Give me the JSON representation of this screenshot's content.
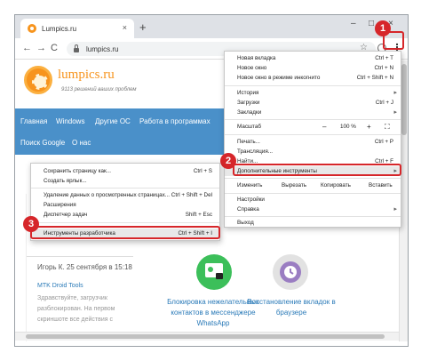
{
  "browser": {
    "tab_title": "Lumpics.ru",
    "tab_close": "×",
    "new_tab": "+",
    "url": "lumpics.ru",
    "nav": {
      "back": "←",
      "forward": "→",
      "reload": "C"
    },
    "star": "☆",
    "menu_dots": "⋮",
    "window": {
      "minimize": "–",
      "maximize": "□",
      "close": "×"
    }
  },
  "site": {
    "name": "lumpics.ru",
    "tagline": "9113 решений ваших проблем",
    "nav": [
      "Главная",
      "Windows",
      "Другие ОС",
      "Работа в программах",
      "Поиск Google",
      "О нас"
    ],
    "author": "Игорь К. 25 сентября в 15:18",
    "link": "MTK Droid Tools",
    "snippet": "Здравствуйте, загрузчик разблокирован. На первом скриншоте все действия с",
    "cards": [
      "Блокировка нежелательных контактов в мессенджере WhatsApp",
      "Восстановление вкладок в браузере"
    ]
  },
  "main_menu": {
    "items_top": [
      {
        "label": "Новая вкладка",
        "shortcut": "Ctrl + T"
      },
      {
        "label": "Новое окно",
        "shortcut": "Ctrl + N"
      },
      {
        "label": "Новое окно в режиме инкогнито",
        "shortcut": "Ctrl + Shift + N"
      }
    ],
    "items_mid": [
      {
        "label": "История",
        "arrow": "▸"
      },
      {
        "label": "Загрузки",
        "shortcut": "Ctrl + J"
      },
      {
        "label": "Закладки",
        "arrow": "▸"
      }
    ],
    "zoom": {
      "label": "Масштаб",
      "minus": "–",
      "value": "100 %",
      "plus": "+",
      "fullscreen": "⛶"
    },
    "items_tools": [
      {
        "label": "Печать...",
        "shortcut": "Ctrl + P"
      },
      {
        "label": "Трансляция..."
      },
      {
        "label": "Найти...",
        "shortcut": "Ctrl + F"
      },
      {
        "label": "Дополнительные инструменты",
        "arrow": "▸"
      }
    ],
    "edit": {
      "label": "Изменить",
      "cut": "Вырезать",
      "copy": "Копировать",
      "paste": "Вставить"
    },
    "items_bottom": [
      {
        "label": "Настройки"
      },
      {
        "label": "Справка",
        "arrow": "▸"
      }
    ],
    "exit": "Выход"
  },
  "sub_menu": {
    "items": [
      {
        "label": "Сохранить страницу как...",
        "shortcut": "Ctrl + S"
      },
      {
        "label": "Создать ярлык..."
      },
      {
        "label": "Удаление данных о просмотренных страницах...",
        "shortcut": "Ctrl + Shift + Del"
      },
      {
        "label": "Расширения"
      },
      {
        "label": "Диспетчер задач",
        "shortcut": "Shift + Esc"
      },
      {
        "label": "Инструменты разработчика",
        "shortcut": "Ctrl + Shift + I"
      }
    ]
  },
  "badges": [
    "1",
    "2",
    "3"
  ],
  "colors": {
    "accent_red": "#d6262a",
    "site_orange": "#f7941d",
    "site_nav_blue": "#4a90c9",
    "link_blue": "#2a7ab8"
  }
}
